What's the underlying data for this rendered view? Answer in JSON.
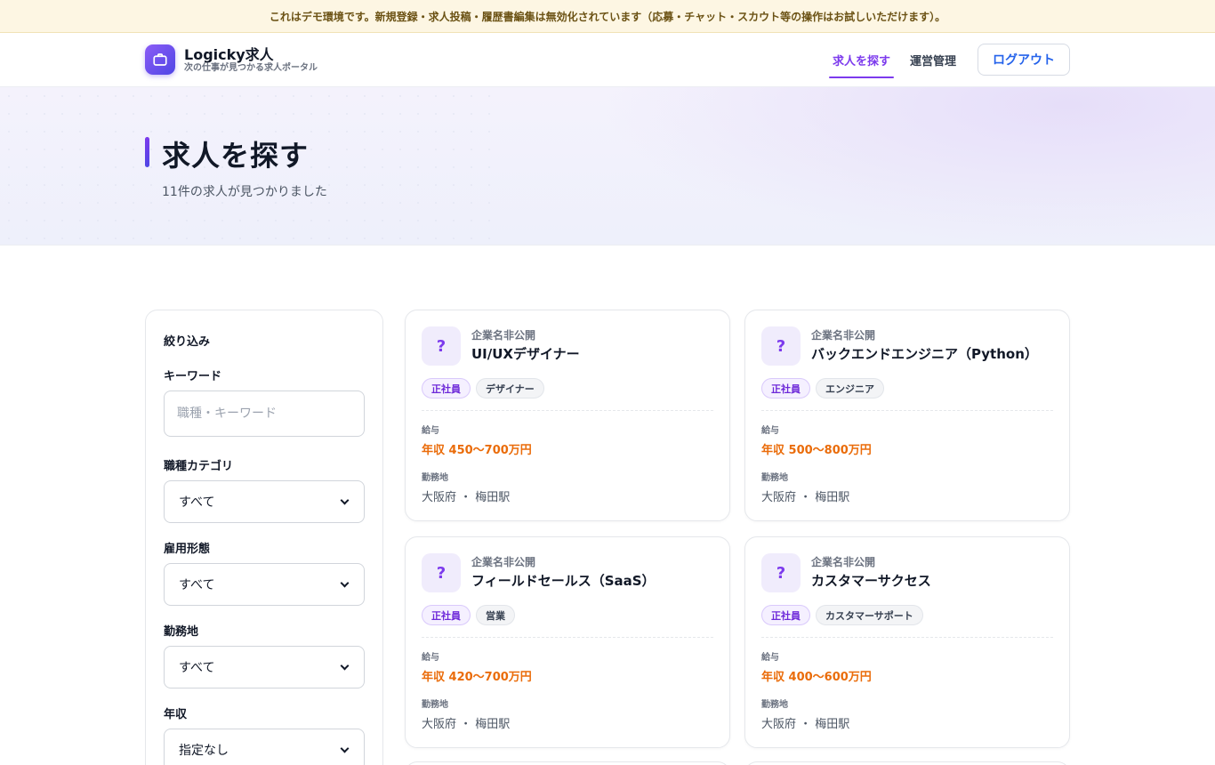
{
  "banner": {
    "text": "これはデモ環境です。新規登録・求人投稿・履歴書編集は無効化されています（応募・チャット・スカウト等の操作はお試しいただけます）。"
  },
  "header": {
    "logo_title": "Logicky求人",
    "logo_subtitle": "次の仕事が見つかる求人ポータル",
    "nav": [
      {
        "label": "求人を探す",
        "active": true
      },
      {
        "label": "運営管理",
        "active": false
      }
    ],
    "logout_label": "ログアウト"
  },
  "hero": {
    "title": "求人を探す",
    "count_text": "11件の求人が見つかりました"
  },
  "filters": {
    "title": "絞り込み",
    "keyword": {
      "label": "キーワード",
      "placeholder": "職種・キーワード"
    },
    "category": {
      "label": "職種カテゴリ",
      "value": "すべて"
    },
    "employment": {
      "label": "雇用形態",
      "value": "すべて"
    },
    "location": {
      "label": "勤務地",
      "value": "すべて"
    },
    "salary": {
      "label": "年収",
      "value": "指定なし"
    }
  },
  "card_labels": {
    "salary": "給与",
    "location": "勤務地"
  },
  "jobs": [
    {
      "icon": "?",
      "company": "企業名非公開",
      "title": "UI/UXデザイナー",
      "type": "正社員",
      "category": "デザイナー",
      "salary": "年収 450〜700万円",
      "location": "大阪府 ・ 梅田駅"
    },
    {
      "icon": "?",
      "company": "企業名非公開",
      "title": "バックエンドエンジニア（Python）",
      "type": "正社員",
      "category": "エンジニア",
      "salary": "年収 500〜800万円",
      "location": "大阪府 ・ 梅田駅"
    },
    {
      "icon": "?",
      "company": "企業名非公開",
      "title": "フィールドセールス（SaaS）",
      "type": "正社員",
      "category": "営業",
      "salary": "年収 420〜700万円",
      "location": "大阪府 ・ 梅田駅"
    },
    {
      "icon": "?",
      "company": "企業名非公開",
      "title": "カスタマーサクセス",
      "type": "正社員",
      "category": "カスタマーサポート",
      "salary": "年収 400〜600万円",
      "location": "大阪府 ・ 梅田駅"
    }
  ]
}
